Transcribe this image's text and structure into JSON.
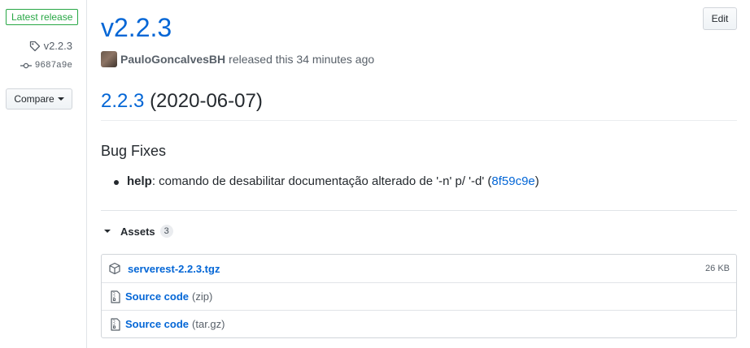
{
  "sidebar": {
    "latest_badge": "Latest release",
    "tag": "v2.2.3",
    "commit": "9687a9e",
    "compare_label": "Compare"
  },
  "release": {
    "title": "v2.2.3",
    "edit_label": "Edit",
    "author": "PauloGoncalvesBH",
    "released_text": "released this 34 minutes ago"
  },
  "notes": {
    "version_link": "2.2.3",
    "version_date": "(2020-06-07)",
    "section_title": "Bug Fixes",
    "fixes": [
      {
        "scope": "help",
        "text": ": comando de desabilitar documentação alterado de '-n' p/ '-d' (",
        "commit": "8f59c9e",
        "close": ")"
      }
    ]
  },
  "assets": {
    "label": "Assets",
    "count": "3",
    "items": [
      {
        "icon": "package-icon",
        "name": "serverest-2.2.3.tgz",
        "ext": "",
        "size": "26 KB"
      },
      {
        "icon": "file-zip-icon",
        "name": "Source code",
        "ext": "(zip)",
        "size": ""
      },
      {
        "icon": "file-zip-icon",
        "name": "Source code",
        "ext": "(tar.gz)",
        "size": ""
      }
    ]
  },
  "colors": {
    "link": "#0366d6",
    "latest_green": "#28a745",
    "muted": "#586069"
  }
}
